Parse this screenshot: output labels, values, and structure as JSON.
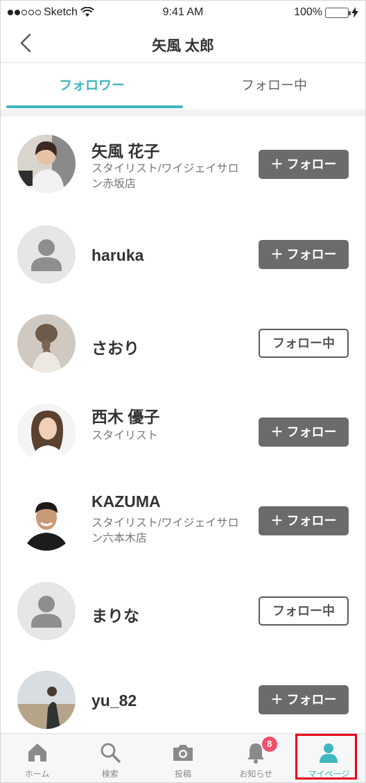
{
  "status_bar": {
    "carrier": "Sketch",
    "time": "9:41 AM",
    "battery": "100%"
  },
  "header": {
    "title": "矢風 太郎"
  },
  "tabs": [
    {
      "label": "フォロワー",
      "active": true
    },
    {
      "label": "フォロー中",
      "active": false
    }
  ],
  "users": [
    {
      "name": "矢風 花子",
      "subtitle": "スタイリスト/ワイジェイサロン赤坂店",
      "button": "＋ フォロー",
      "following": false
    },
    {
      "name": "haruka",
      "subtitle": "",
      "button": "＋ フォロー",
      "following": false
    },
    {
      "name": "さおり",
      "subtitle": "",
      "button": "フォロー中",
      "following": true
    },
    {
      "name": "西木 優子",
      "subtitle": "スタイリスト",
      "button": "＋ フォロー",
      "following": false
    },
    {
      "name": "KAZUMA",
      "subtitle": "スタイリスト/ワイジェイサロン六本木店",
      "button": "＋ フォロー",
      "following": false
    },
    {
      "name": "まりな",
      "subtitle": "",
      "button": "フォロー中",
      "following": true
    },
    {
      "name": "yu_82",
      "subtitle": "",
      "button": "＋ フォロー",
      "following": false
    }
  ],
  "tabbar": {
    "items": [
      {
        "label": "ホーム",
        "icon": "home-icon"
      },
      {
        "label": "検索",
        "icon": "search-icon"
      },
      {
        "label": "投稿",
        "icon": "camera-icon"
      },
      {
        "label": "お知らせ",
        "icon": "bell-icon",
        "badge": "8"
      },
      {
        "label": "マイページ",
        "icon": "person-icon",
        "active": true
      }
    ]
  },
  "colors": {
    "accent": "#3fb7c0",
    "follow_button": "#6b6b6b",
    "badge": "#f0506e",
    "highlight": "#e8001c"
  }
}
